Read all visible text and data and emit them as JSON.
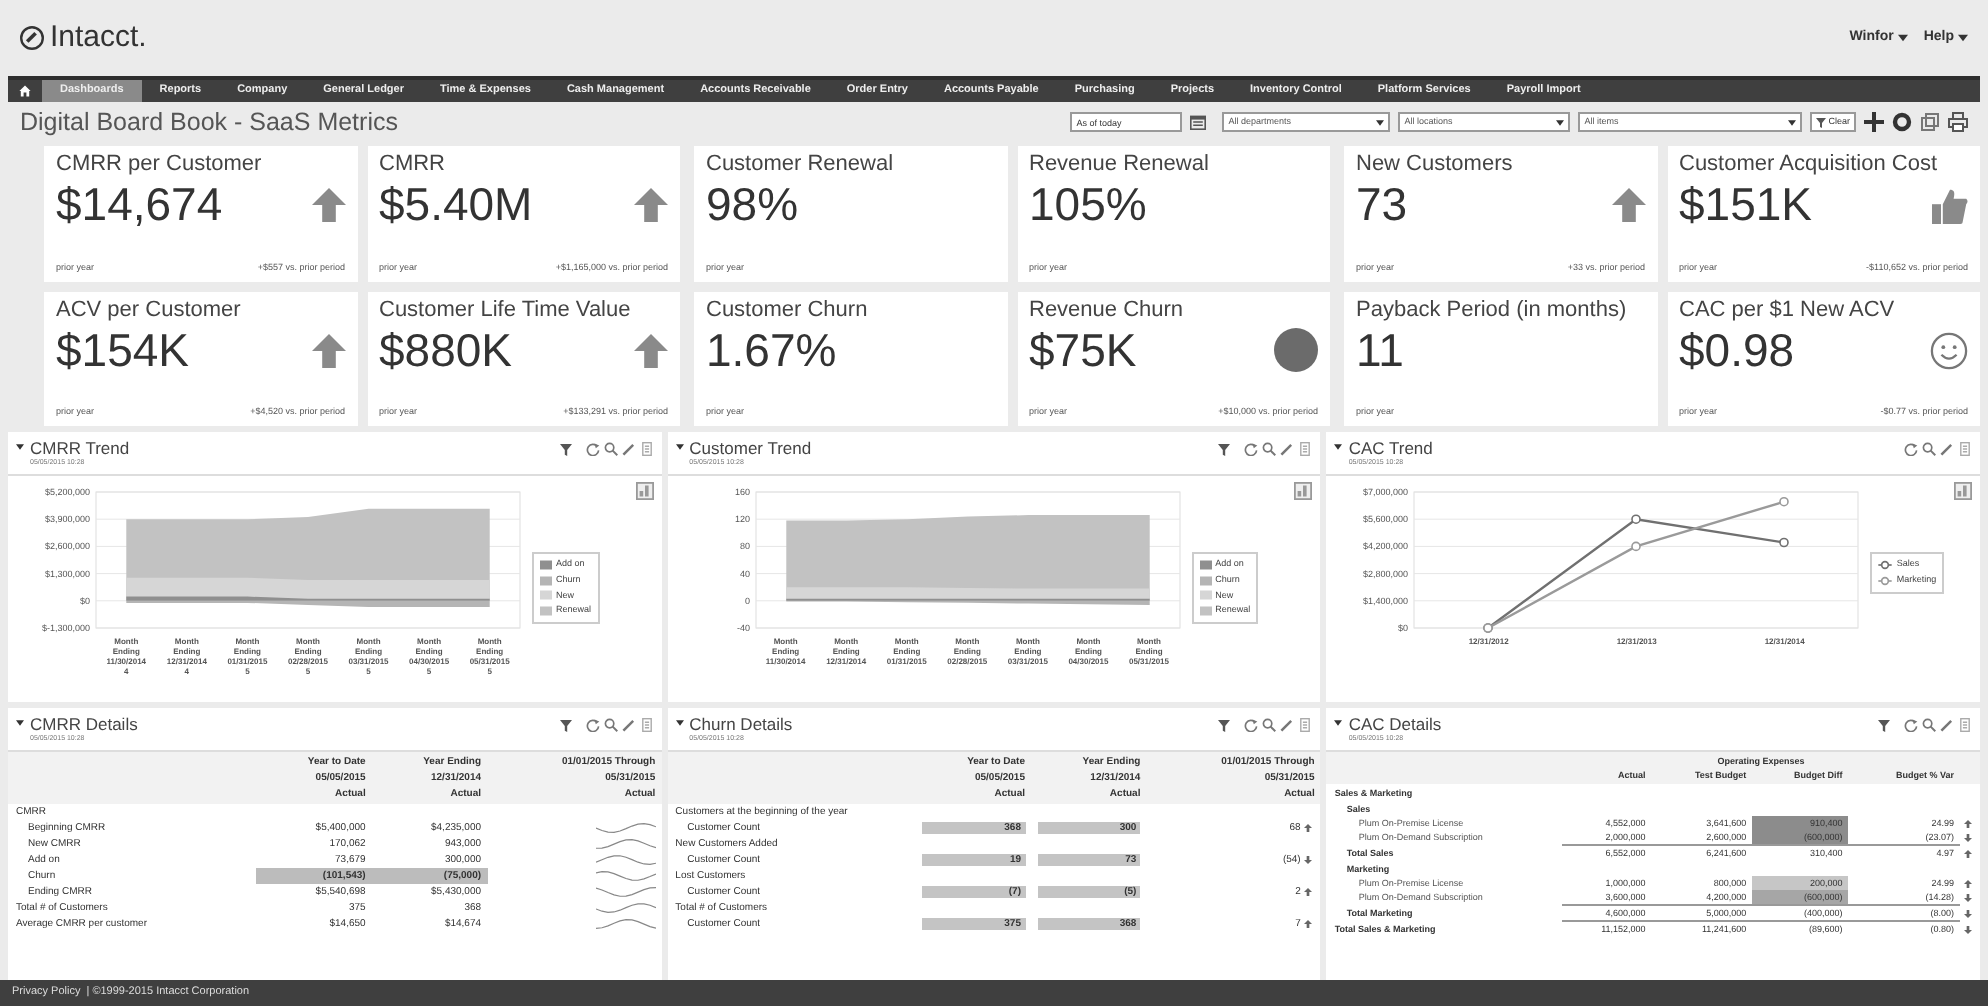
{
  "header": {
    "logo": "Intacct.",
    "menus": [
      {
        "label": "Winfor"
      },
      {
        "label": "Help"
      }
    ]
  },
  "nav": [
    {
      "label": "Dashboards",
      "selected": true
    },
    {
      "label": "Reports",
      "selected": false
    },
    {
      "label": "Company",
      "selected": false
    },
    {
      "label": "General Ledger",
      "selected": false
    },
    {
      "label": "Time & Expenses",
      "selected": false
    },
    {
      "label": "Cash Management",
      "selected": false
    },
    {
      "label": "Accounts Receivable",
      "selected": false
    },
    {
      "label": "Order Entry",
      "selected": false
    },
    {
      "label": "Accounts Payable",
      "selected": false
    },
    {
      "label": "Purchasing",
      "selected": false
    },
    {
      "label": "Projects",
      "selected": false
    },
    {
      "label": "Inventory Control",
      "selected": false
    },
    {
      "label": "Platform Services",
      "selected": false
    },
    {
      "label": "Payroll Import",
      "selected": false
    }
  ],
  "page_title": "Digital Board Book - SaaS Metrics",
  "filters": {
    "as_of": "As of today",
    "selects": [
      {
        "value": "All departments"
      },
      {
        "value": "All locations"
      },
      {
        "value": "All items"
      }
    ],
    "clear": "Clear"
  },
  "kpi_groups": [
    [
      {
        "title": "CMRR per Customer",
        "value": "$14,674",
        "kind": "rising",
        "period": "prior year",
        "delta": "+$557 vs. prior period"
      },
      {
        "title": "CMRR",
        "value": "$5.40M",
        "kind": "rising",
        "period": "prior year",
        "delta": "+$1,165,000 vs. prior period"
      },
      {
        "title": "ACV per Customer",
        "value": "$154K",
        "kind": "rising",
        "period": "prior year",
        "delta": "+$4,520 vs. prior period"
      },
      {
        "title": "Customer Life Time Value",
        "value": "$880K",
        "kind": "rising",
        "period": "prior year",
        "delta": "+$133,291 vs. prior period"
      }
    ],
    [
      {
        "title": "Customer Renewal",
        "value": "98%",
        "kind": "plain",
        "period": "prior year"
      },
      {
        "title": "Revenue Renewal",
        "value": "105%",
        "kind": "plain",
        "period": "prior year"
      },
      {
        "title": "Customer Churn",
        "value": "1.67%",
        "kind": "plain",
        "period": "prior year"
      },
      {
        "title": "Revenue Churn",
        "value": "$75K",
        "kind": "status",
        "period": "prior year",
        "delta": "+$10,000 vs. prior period"
      }
    ],
    [
      {
        "title": "New Customers",
        "value": "73",
        "kind": "rising",
        "period": "prior year",
        "delta": "+33 vs. prior period"
      },
      {
        "title": "Customer Acquisition Cost",
        "value": "$151K",
        "kind": "approved",
        "period": "prior year",
        "delta": "-$110,652 vs. prior period"
      },
      {
        "title": "Payback Period (in months)",
        "value": "11",
        "kind": "plain",
        "period": "prior year"
      },
      {
        "title": "CAC per $1 New ACV",
        "value": "$0.98",
        "kind": "happy",
        "period": "prior year",
        "delta": "-$0.77 vs. prior period"
      }
    ]
  ],
  "trend_panels": [
    {
      "title": "CMRR Trend",
      "timestamp": "05/05/2015 10:28",
      "filter": true,
      "chart_data": {
        "type": "area",
        "ylim": [
          -1300000,
          5200000
        ],
        "grid": true,
        "legend": "right",
        "categories": [
          "Month Ending 11/30/2014 4",
          "Month Ending 12/31/2014 4",
          "Month Ending 01/31/2015 5",
          "Month Ending 02/28/2015 5",
          "Month Ending 03/31/2015 5",
          "Month Ending 04/30/2015 5",
          "Month Ending 05/31/2015 5"
        ],
        "yticks": [
          {
            "value": 5200000,
            "label": "$5,200,000"
          },
          {
            "value": 3900000,
            "label": "$3,900,000"
          },
          {
            "value": 2600000,
            "label": "$2,600,000"
          },
          {
            "value": 1300000,
            "label": "$1,300,000"
          },
          {
            "value": 0,
            "label": "$0"
          },
          {
            "value": -1300000,
            "label": "$-1,300,000"
          }
        ],
        "series": [
          {
            "name": "Add on",
            "color": "#8f8f8f",
            "values": [
              200000,
              200000,
              200000,
              100000,
              100000,
              100000,
              100000
            ]
          },
          {
            "name": "Churn",
            "color": "#b5b5b5",
            "values": [
              -100000,
              -100000,
              -100000,
              -200000,
              -300000,
              -300000,
              -300000
            ]
          },
          {
            "name": "New",
            "color": "#d6d6d6",
            "values": [
              1100000,
              1100000,
              1100000,
              1000000,
              1000000,
              1000000,
              1000000
            ]
          },
          {
            "name": "Renewal",
            "color": "#c2c2c2",
            "values": [
              3900000,
              3900000,
              3900000,
              4000000,
              4400000,
              4400000,
              4400000
            ]
          }
        ]
      }
    },
    {
      "title": "Customer Trend",
      "timestamp": "05/05/2015 10:28",
      "filter": true,
      "chart_data": {
        "type": "area",
        "ylim": [
          -40,
          160
        ],
        "grid": true,
        "legend": "right",
        "categories": [
          "Month Ending 11/30/2014",
          "Month Ending 12/31/2014",
          "Month Ending 01/31/2015",
          "Month Ending 02/28/2015",
          "Month Ending 03/31/2015",
          "Month Ending 04/30/2015",
          "Month Ending 05/31/2015"
        ],
        "yticks": [
          {
            "value": 160,
            "label": "160"
          },
          {
            "value": 120,
            "label": "120"
          },
          {
            "value": 80,
            "label": "80"
          },
          {
            "value": 40,
            "label": "40"
          },
          {
            "value": 0,
            "label": "0"
          },
          {
            "value": -40,
            "label": "-40"
          }
        ],
        "series": [
          {
            "name": "Add on",
            "color": "#8f8f8f",
            "values": [
              3,
              3,
              3,
              3,
              3,
              3,
              3
            ]
          },
          {
            "name": "Churn",
            "color": "#b5b5b5",
            "values": [
              -1,
              -1,
              -2,
              -3,
              -4,
              -5,
              -6
            ]
          },
          {
            "name": "New",
            "color": "#d6d6d6",
            "values": [
              20,
              20,
              20,
              19,
              18,
              18,
              18
            ]
          },
          {
            "name": "Renewal",
            "color": "#c2c2c2",
            "values": [
              118,
              118,
              120,
              124,
              126,
              126,
              126
            ]
          }
        ]
      }
    },
    {
      "title": "CAC Trend",
      "timestamp": "05/05/2015 10:28",
      "filter": false,
      "chart_data": {
        "type": "line",
        "ylim": [
          0,
          7000000
        ],
        "grid": true,
        "legend": "right",
        "categories": [
          "12/31/2012",
          "12/31/2013",
          "12/31/2014"
        ],
        "yticks": [
          {
            "value": 7000000,
            "label": "$7,000,000"
          },
          {
            "value": 5600000,
            "label": "$5,600,000"
          },
          {
            "value": 4200000,
            "label": "$4,200,000"
          },
          {
            "value": 2800000,
            "label": "$2,800,000"
          },
          {
            "value": 1400000,
            "label": "$1,400,000"
          },
          {
            "value": 0,
            "label": "$0"
          }
        ],
        "series": [
          {
            "name": "Sales",
            "color": "#707070",
            "marker": "circle",
            "values": [
              0,
              5600000,
              4400000
            ]
          },
          {
            "name": "Marketing",
            "color": "#9a9a9a",
            "marker": "circle",
            "values": [
              0,
              4200000,
              6500000
            ]
          }
        ]
      }
    }
  ],
  "cmrr_details": {
    "title": "CMRR Details",
    "timestamp": "05/05/2015 10:28",
    "filter": true,
    "columns": [
      [
        "Year to Date",
        "05/05/2015",
        "Actual"
      ],
      [
        "Year Ending",
        "12/31/2014",
        "Actual"
      ],
      [
        "01/01/2015 Through",
        "05/31/2015",
        "Actual"
      ]
    ],
    "rows": [
      {
        "label": "CMRR",
        "children": [
          {
            "label": "Beginning CMRR",
            "values": [
              "$5,400,000",
              "$4,235,000"
            ],
            "highlight": false
          },
          {
            "label": "New CMRR",
            "values": [
              "170,062",
              "943,000"
            ],
            "highlight": false
          },
          {
            "label": "Add on",
            "values": [
              "73,679",
              "300,000"
            ],
            "highlight": false
          },
          {
            "label": "Churn",
            "values": [
              "(101,543)",
              "(75,000)"
            ],
            "highlight": true
          },
          {
            "label": "Ending CMRR",
            "values": [
              "$5,540,698",
              "$5,430,000"
            ],
            "highlight": false
          }
        ]
      },
      {
        "label": "Total # of Customers",
        "values": [
          "375",
          "368"
        ],
        "highlight": false
      },
      {
        "label": "Average CMRR per customer",
        "values": [
          "$14,650",
          "$14,674"
        ],
        "highlight": false
      }
    ]
  },
  "churn_details": {
    "title": "Churn Details",
    "timestamp": "05/05/2015 10:28",
    "filter": true,
    "columns": [
      [
        "Year to Date",
        "05/05/2015",
        "Actual"
      ],
      [
        "Year Ending",
        "12/31/2014",
        "Actual"
      ],
      [
        "01/01/2015 Through",
        "05/31/2015",
        "Actual"
      ]
    ],
    "rows": [
      {
        "label": "Customers at the beginning of the year",
        "children": [
          {
            "label": "Customer Count",
            "values": [
              "368",
              "300"
            ],
            "change": "68",
            "up": true
          }
        ]
      },
      {
        "label": "New Customers Added",
        "children": [
          {
            "label": "Customer Count",
            "values": [
              "19",
              "73"
            ],
            "change": "(54)",
            "up": false
          }
        ]
      },
      {
        "label": "Lost Customers",
        "children": [
          {
            "label": "Customer Count",
            "values": [
              "(7)",
              "(5)"
            ],
            "change": "2",
            "up": true
          }
        ]
      },
      {
        "label": "Total # of Customers",
        "children": [
          {
            "label": "Customer Count",
            "values": [
              "375",
              "368"
            ],
            "change": "7",
            "up": true
          }
        ]
      }
    ]
  },
  "cac_details": {
    "title": "CAC Details",
    "timestamp": "05/05/2015 10:28",
    "filter": true,
    "column_group": "Operating Expenses",
    "columns": [
      "Actual",
      "Test Budget",
      "Budget Diff",
      "Budget % Var"
    ],
    "rows": [
      {
        "label": "Sales & Marketing",
        "kind": "group",
        "children": [
          {
            "label": "Sales",
            "kind": "group",
            "children": [
              {
                "label": "Plum On-Premise License",
                "kind": "line",
                "values": [
                  "4,552,000",
                  "3,641,600",
                  "910,400",
                  "24.99"
                ],
                "color": "#8c8c8c",
                "up": true
              },
              {
                "label": "Plum On-Demand Subscription",
                "kind": "line",
                "values": [
                  "2,000,000",
                  "2,600,000",
                  "(600,000)",
                  "(23.07)"
                ],
                "color": "#8c8c8c",
                "up": false
              }
            ]
          },
          {
            "label": "Total Sales",
            "kind": "total",
            "values": [
              "6,552,000",
              "6,241,600",
              "310,400",
              "4.97"
            ],
            "up": true
          },
          {
            "label": "Marketing",
            "kind": "group",
            "children": [
              {
                "label": "Plum On-Premise License",
                "kind": "line",
                "values": [
                  "1,000,000",
                  "800,000",
                  "200,000",
                  "24.99"
                ],
                "color": "#c6c6c6",
                "up": true
              },
              {
                "label": "Plum On-Demand Subscription",
                "kind": "line",
                "values": [
                  "3,600,000",
                  "4,200,000",
                  "(600,000)",
                  "(14.28)"
                ],
                "color": "#a6a6a6",
                "up": false
              }
            ]
          },
          {
            "label": "Total Marketing",
            "kind": "total",
            "values": [
              "4,600,000",
              "5,000,000",
              "(400,000)",
              "(8.00)"
            ],
            "up": false
          }
        ]
      },
      {
        "label": "Total Sales & Marketing",
        "kind": "total",
        "values": [
          "11,152,000",
          "11,241,600",
          "(89,600)",
          "(0.80)"
        ],
        "up": false
      }
    ]
  },
  "footer": {
    "link": "Privacy Policy",
    "text": "| ©1999-2015 Intacct Corporation"
  }
}
